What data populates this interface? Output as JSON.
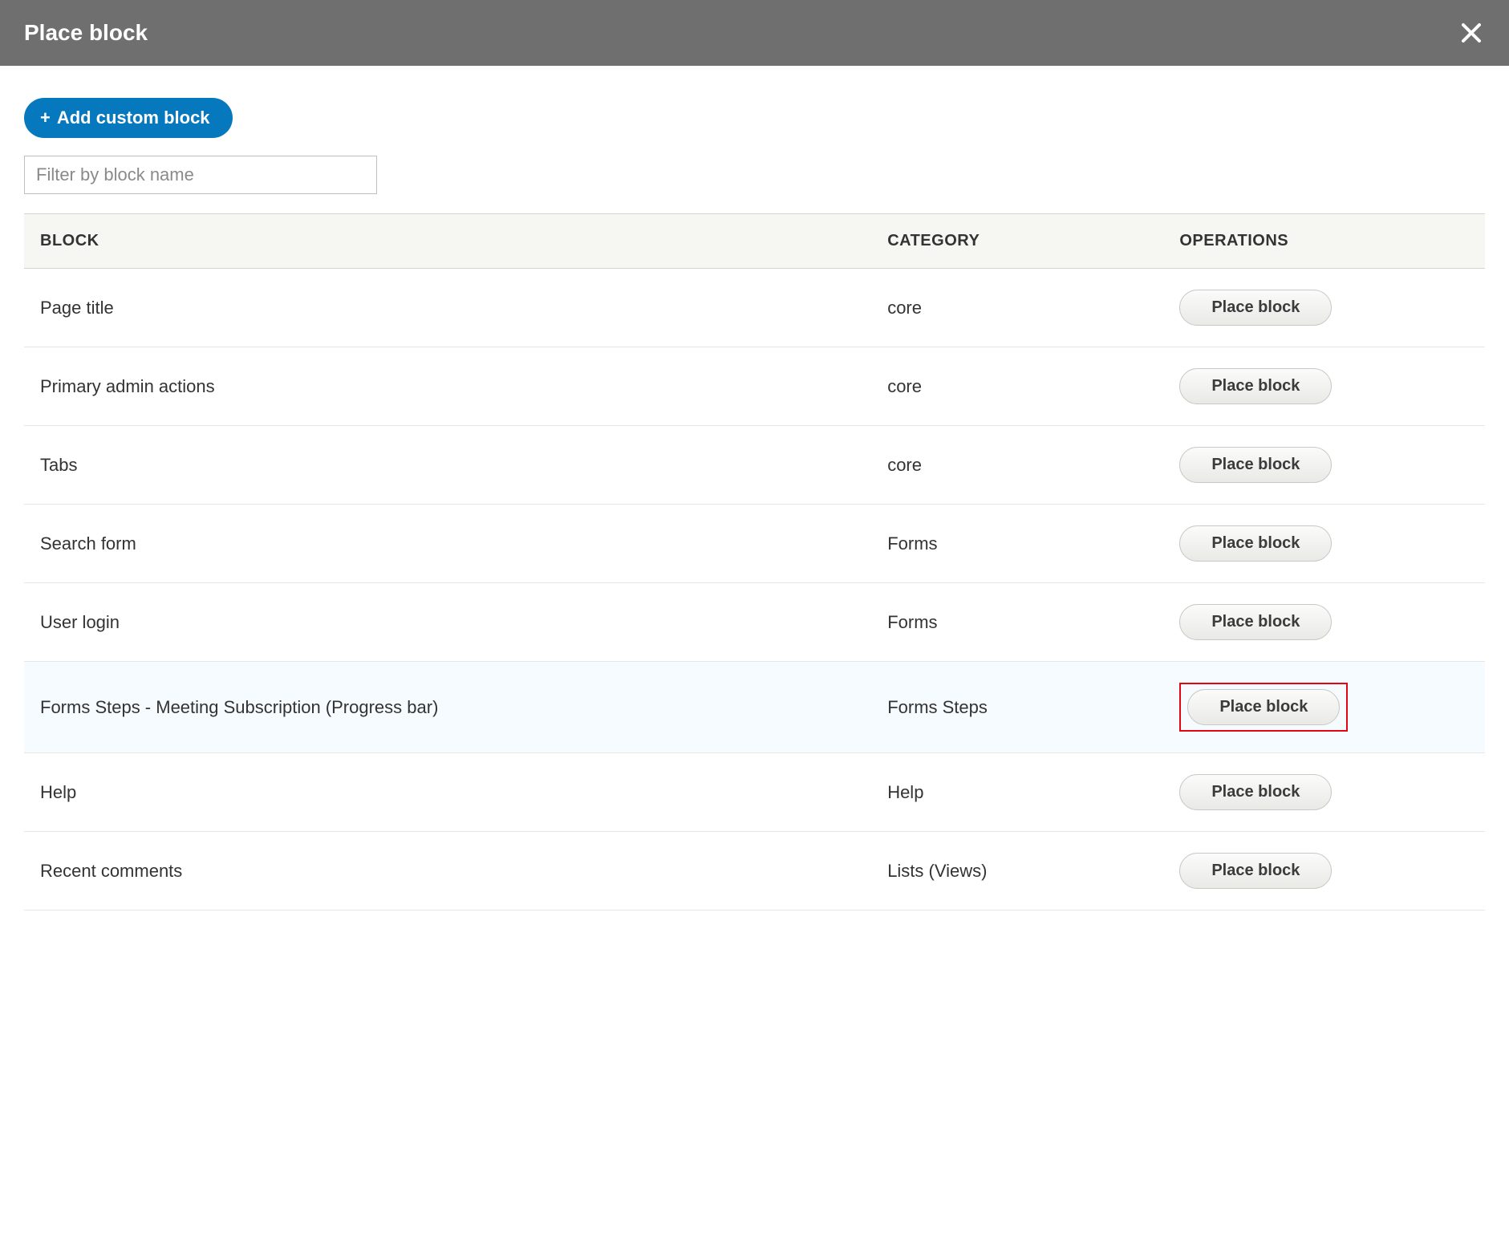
{
  "dialog": {
    "title": "Place block",
    "add_button_label": "Add custom block",
    "filter_placeholder": "Filter by block name"
  },
  "table": {
    "headers": {
      "block": "BLOCK",
      "category": "CATEGORY",
      "operations": "OPERATIONS"
    },
    "rows": [
      {
        "block": "Page title",
        "category": "core",
        "op_label": "Place block",
        "highlight": false
      },
      {
        "block": "Primary admin actions",
        "category": "core",
        "op_label": "Place block",
        "highlight": false
      },
      {
        "block": "Tabs",
        "category": "core",
        "op_label": "Place block",
        "highlight": false
      },
      {
        "block": "Search form",
        "category": "Forms",
        "op_label": "Place block",
        "highlight": false
      },
      {
        "block": "User login",
        "category": "Forms",
        "op_label": "Place block",
        "highlight": false
      },
      {
        "block": "Forms Steps - Meeting Subscription (Progress bar)",
        "category": "Forms Steps",
        "op_label": "Place block",
        "highlight": true
      },
      {
        "block": "Help",
        "category": "Help",
        "op_label": "Place block",
        "highlight": false
      },
      {
        "block": "Recent comments",
        "category": "Lists (Views)",
        "op_label": "Place block",
        "highlight": false
      }
    ]
  }
}
